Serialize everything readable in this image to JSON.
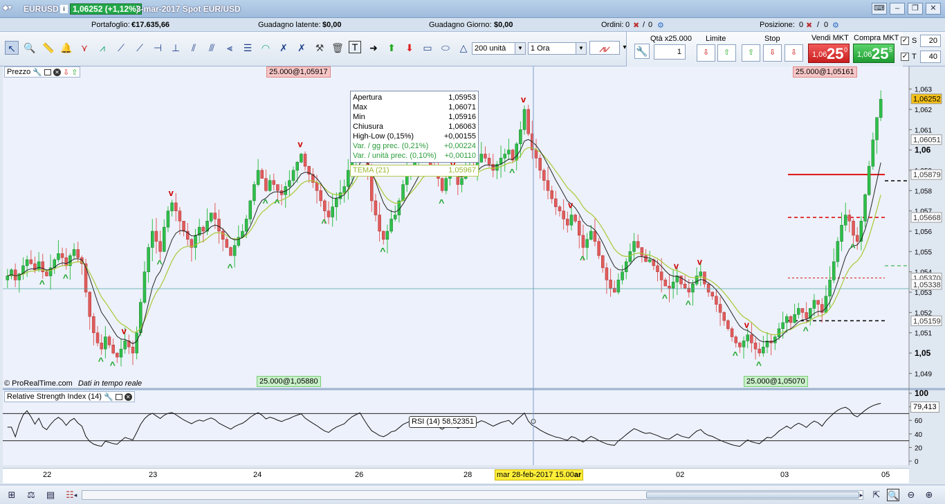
{
  "window": {
    "symbol": "EURUSD",
    "price_change": "1,06252 (+1,12%)",
    "date_info": "3-mar-2017 Spot EUR/USD"
  },
  "portfolio": {
    "portafoglio_label": "Portafoglio:",
    "portafoglio_value": "€17.635,66",
    "latente_label": "Guadagno latente:",
    "latente_value": "$0,00",
    "giorno_label": "Guadagno Giorno:",
    "giorno_value": "$0,00",
    "ordini_label": "Ordini:",
    "ordini_value": "0",
    "ordini_slash": "/",
    "ordini_value2": "0",
    "posizione_label": "Posizione:",
    "posizione_value": "0",
    "posizione_slash": "/",
    "posizione_value2": "0"
  },
  "toolbar": {
    "units_select": "200 unità",
    "period_select": "1 Ora",
    "qty_label": "Qtà x25.000",
    "qty_value": "1",
    "limite_label": "Limite",
    "stop_label": "Stop",
    "vendi_label": "Vendi MKT",
    "compra_label": "Compra MKT",
    "vendi_small": "1,06",
    "vendi_big": "25",
    "vendi_sup": "0",
    "compra_small": "1,06",
    "compra_big": "25",
    "compra_sup": "5",
    "s_label": "S",
    "s_value": "20",
    "t_label": "T",
    "t_value": "40"
  },
  "chart": {
    "price_panel_title": "Prezzo",
    "rsi_panel_title": "Relative Strength Index (14)",
    "top_left_label": "25.000@1,05917",
    "top_right_label": "25.000@1,05161",
    "bottom_left_label": "25.000@1,05880",
    "bottom_right_label": "25.000@1,05070",
    "copyright": "© ProRealTime.com",
    "realtime": "Dati in tempo reale",
    "cursor_date": "mar 28-feb-2017 15.00",
    "cursor_date_tail": "ar",
    "rsi_label": "RSI (14)",
    "rsi_value": "58,52351",
    "rsi_current": "79,413",
    "colors": {
      "up": "#2fbf4a",
      "down": "#e15b5b",
      "background": "#edf1fb",
      "tema": "#a8c832"
    }
  },
  "tooltip": {
    "rows": [
      {
        "label": "Apertura",
        "value": "1,05953"
      },
      {
        "label": "Max",
        "value": "1,06071"
      },
      {
        "label": "Min",
        "value": "1,05916"
      },
      {
        "label": "Chiusura",
        "value": "1,06063"
      },
      {
        "label": "High-Low (0,15%)",
        "value": "+0,00155"
      },
      {
        "label": "Var. / gg prec. (0,21%)",
        "value": "+0,00224"
      },
      {
        "label": "Var. / unità prec. (0,10%)",
        "value": "+0,00110"
      }
    ],
    "tema_label": "TEMA (21)",
    "tema_value": "1,05967"
  },
  "chart_data": {
    "type": "candlestick",
    "x_tick_labels": [
      "22",
      "23",
      "24",
      "26",
      "28",
      "02",
      "03",
      "05"
    ],
    "y_tick_labels": [
      "1,063",
      "1,062",
      "1,061",
      "1,06",
      "1,059",
      "1,058",
      "1,057",
      "1,056",
      "1,055",
      "1,054",
      "1,053",
      "1,052",
      "1,051",
      "1,05",
      "1,049"
    ],
    "ylim": [
      1.0485,
      1.0635
    ],
    "price_tags": [
      {
        "text": "1,06252",
        "value": 1.06252,
        "color": "#f3c018"
      },
      {
        "text": "1,06051",
        "value": 1.06051,
        "color": "#ffffff"
      },
      {
        "text": "1,05879",
        "value": 1.05879,
        "color": "#ffffff"
      },
      {
        "text": "1,05668",
        "value": 1.05668,
        "color": "#ffffff"
      },
      {
        "text": "1,05370",
        "value": 1.0537,
        "color": "#ffffff"
      },
      {
        "text": "1,05338",
        "value": 1.05338,
        "color": "#ffffff"
      },
      {
        "text": "1,05159",
        "value": 1.05159,
        "color": "#ffffff"
      }
    ],
    "rsi_tick_labels": [
      "100",
      "80",
      "60",
      "40",
      "20",
      "0"
    ],
    "rsi_levels": [
      70,
      30
    ],
    "rsi_ylim": [
      0,
      100
    ],
    "close_series": [
      1.0538,
      1.0541,
      1.0536,
      1.0539,
      1.0543,
      1.0546,
      1.0544,
      1.0541,
      1.0545,
      1.054,
      1.0538,
      1.0542,
      1.0546,
      1.0549,
      1.0547,
      1.0543,
      1.0548,
      1.0551,
      1.0547,
      1.0544,
      1.053,
      1.0518,
      1.051,
      1.0505,
      1.0502,
      1.0508,
      1.0504,
      1.05,
      1.0498,
      1.0502,
      1.0506,
      1.0503,
      1.05,
      1.051,
      1.0525,
      1.054,
      1.0552,
      1.056,
      1.0555,
      1.055,
      1.0562,
      1.057,
      1.0574,
      1.057,
      1.0565,
      1.056,
      1.0556,
      1.0552,
      1.0558,
      1.0562,
      1.056,
      1.0565,
      1.0569,
      1.0566,
      1.056,
      1.0556,
      1.0552,
      1.0548,
      1.0553,
      1.0557,
      1.056,
      1.0566,
      1.0575,
      1.0583,
      1.059,
      1.0586,
      1.058,
      1.0585,
      1.0583,
      1.058,
      1.0578,
      1.0582,
      1.0585,
      1.059,
      1.0594,
      1.0598,
      1.0592,
      1.0588,
      1.0584,
      1.058,
      1.0575,
      1.057,
      1.0567,
      1.0572,
      1.0576,
      1.0579,
      1.0582,
      1.059,
      1.0598,
      1.0604,
      1.061,
      1.06,
      1.0588,
      1.0575,
      1.0568,
      1.056,
      1.0556,
      1.056,
      1.0566,
      1.0568,
      1.0575,
      1.0583,
      1.0588,
      1.0592,
      1.0595,
      1.06,
      1.0604,
      1.0598,
      1.0592,
      1.059,
      1.0586,
      1.058,
      1.0586,
      1.059,
      1.0588,
      1.0583,
      1.0586,
      1.0589,
      1.0591,
      1.059,
      1.0594,
      1.0598,
      1.0596,
      1.0593,
      1.059,
      1.0593,
      1.0596,
      1.0598,
      1.06,
      1.0595,
      1.0603,
      1.061,
      1.062,
      1.0608,
      1.06,
      1.0596,
      1.059,
      1.0585,
      1.058,
      1.0576,
      1.0572,
      1.057,
      1.0566,
      1.0563,
      1.0568,
      1.0565,
      1.0558,
      1.0552,
      1.0556,
      1.056,
      1.0555,
      1.0548,
      1.0542,
      1.0536,
      1.0532,
      1.053,
      1.0536,
      1.054,
      1.0545,
      1.055,
      1.0555,
      1.0552,
      1.0548,
      1.0545,
      1.0546,
      1.0543,
      1.054,
      1.0536,
      1.0533,
      1.0532,
      1.0535,
      1.0538,
      1.0534,
      1.0532,
      1.053,
      1.0534,
      1.0538,
      1.054,
      1.0534,
      1.053,
      1.0528,
      1.0524,
      1.052,
      1.0516,
      1.0512,
      1.0508,
      1.0505,
      1.0503,
      1.0506,
      1.0509,
      1.0505,
      1.0502,
      1.05,
      1.0503,
      1.0506,
      1.0505,
      1.0508,
      1.0512,
      1.0515,
      1.0518,
      1.0515,
      1.0519,
      1.0522,
      1.052,
      1.0517,
      1.0522,
      1.0526,
      1.0524,
      1.052,
      1.0528,
      1.0536,
      1.0545,
      1.0555,
      1.0563,
      1.0568,
      1.0565,
      1.0558,
      1.0555,
      1.0565,
      1.0578,
      1.0592,
      1.0605,
      1.0616,
      1.0625
    ]
  }
}
